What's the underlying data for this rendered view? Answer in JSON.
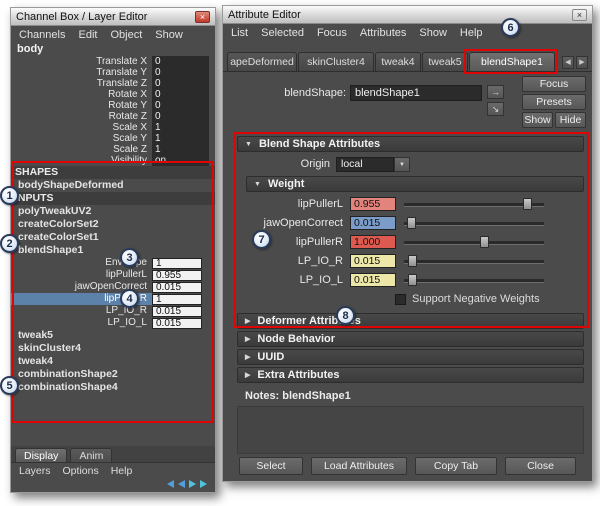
{
  "icons": {
    "close": "×",
    "section_open": "▼",
    "section_closed": "▶",
    "tab_prev": "◀",
    "tab_next": "▶",
    "dropdown_arrow": "▼",
    "node_nav_out": "→",
    "node_nav_in": "↘"
  },
  "callouts": [
    "1",
    "2",
    "3",
    "4",
    "5",
    "6",
    "7",
    "8"
  ],
  "channel_box": {
    "title": "Channel Box / Layer Editor",
    "menus": [
      "Channels",
      "Edit",
      "Object",
      "Show"
    ],
    "object_name": "body",
    "transform_rows": [
      {
        "label": "Translate X",
        "value": "0"
      },
      {
        "label": "Translate Y",
        "value": "0"
      },
      {
        "label": "Translate Z",
        "value": "0"
      },
      {
        "label": "Rotate X",
        "value": "0"
      },
      {
        "label": "Rotate Y",
        "value": "0"
      },
      {
        "label": "Rotate Z",
        "value": "0"
      },
      {
        "label": "Scale X",
        "value": "1"
      },
      {
        "label": "Scale Y",
        "value": "1"
      },
      {
        "label": "Scale Z",
        "value": "1"
      },
      {
        "label": "Visibility",
        "value": "on"
      }
    ],
    "shapes_header": "SHAPES",
    "shapes_items": [
      "bodyShapeDeformed"
    ],
    "inputs_header": "INPUTS",
    "inputs_items": [
      "polyTweakUV2",
      "createColorSet2",
      "createColorSet1",
      "blendShape1"
    ],
    "blendshape_rows": [
      {
        "label": "Envelope",
        "value": "1"
      },
      {
        "label": "lipPullerL",
        "value": "0.955"
      },
      {
        "label": "jawOpenCorrect",
        "value": "0.015"
      },
      {
        "label": "lipPullerR",
        "value": "1"
      },
      {
        "label": "LP_IO_R",
        "value": "0.015"
      },
      {
        "label": "LP_IO_L",
        "value": "0.015"
      }
    ],
    "history_items": [
      "tweak5",
      "skinCluster4",
      "tweak4",
      "combinationShape2",
      "combinationShape4"
    ],
    "bottom_tabs": [
      "Display",
      "Anim"
    ],
    "bottom_menus": [
      "Layers",
      "Options",
      "Help"
    ]
  },
  "attribute_editor": {
    "title": "Attribute Editor",
    "menus": [
      "List",
      "Selected",
      "Focus",
      "Attributes",
      "Show",
      "Help"
    ],
    "tabs": [
      "apeDeformed",
      "skinCluster4",
      "tweak4",
      "tweak5",
      "blendShape1"
    ],
    "selected_tab": "blendShape1",
    "node_type_label": "blendShape:",
    "node_name": "blendShape1",
    "focus_button": "Focus",
    "presets_button": "Presets",
    "show_button": "Show",
    "hide_button": "Hide",
    "blend_shape_section": "Blend Shape Attributes",
    "origin_label": "Origin",
    "origin_value": "local",
    "weight_section": "Weight",
    "weight_rows": [
      {
        "label": "lipPullerL",
        "value": "0.955",
        "box_color": "#e2837c",
        "slider_pct": 88
      },
      {
        "label": "jawOpenCorrect",
        "value": "0.015",
        "box_color": "#7b9cc9",
        "slider_pct": 5
      },
      {
        "label": "lipPullerR",
        "value": "1.000",
        "box_color": "#de5a50",
        "slider_pct": 57
      },
      {
        "label": "LP_IO_R",
        "value": "0.015",
        "box_color": "#ece7a8",
        "slider_pct": 6
      },
      {
        "label": "LP_IO_L",
        "value": "0.015",
        "box_color": "#ece7a8",
        "slider_pct": 6
      }
    ],
    "support_negative_label": "Support Negative Weights",
    "collapsed_sections": [
      "Deformer Attributes",
      "Node Behavior",
      "UUID",
      "Extra Attributes"
    ],
    "notes_label": "Notes: blendShape1",
    "footer_buttons": [
      "Select",
      "Load Attributes",
      "Copy Tab",
      "Close"
    ]
  }
}
